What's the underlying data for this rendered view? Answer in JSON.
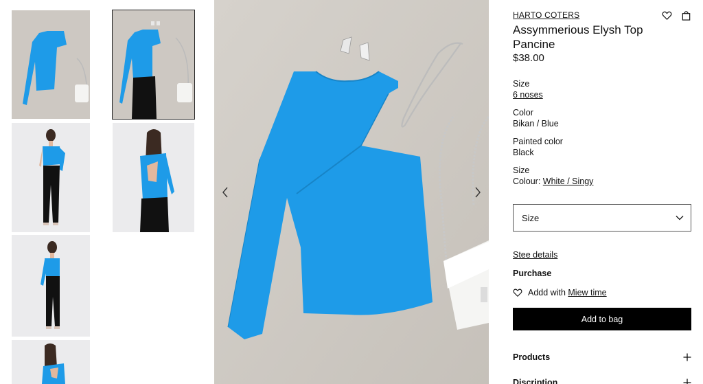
{
  "product": {
    "brand": "HARTO COTERS",
    "title": "Assymmerious Elysh Top Pancine",
    "price": "$38.00"
  },
  "specs": [
    {
      "label": "Size",
      "value": "6 noses"
    },
    {
      "label": "Color",
      "value": "Bikan / Blue"
    },
    {
      "label": "Painted color",
      "value": "Black"
    },
    {
      "label": "Size",
      "value_prefix": "Colour: ",
      "value": "White / Singy"
    }
  ],
  "size_select": {
    "label": "Size"
  },
  "details_link": "Stee details",
  "purchase": {
    "label": "Purchase",
    "wish_prefix": "Addd with ",
    "wish_link": "Miew time",
    "add_button": "Add to bag"
  },
  "accordions": [
    "Products",
    "Discription"
  ],
  "icons": {
    "wishlist": "heart-icon",
    "bag": "shopping-bag-icon",
    "chevron_down": "chevron-down-icon",
    "plus": "plus-icon",
    "prev": "chevron-left-icon",
    "next": "chevron-right-icon"
  },
  "colors": {
    "product_blue": "#1e9be8",
    "button_black": "#000000",
    "background_concrete": "#cfcac4"
  }
}
